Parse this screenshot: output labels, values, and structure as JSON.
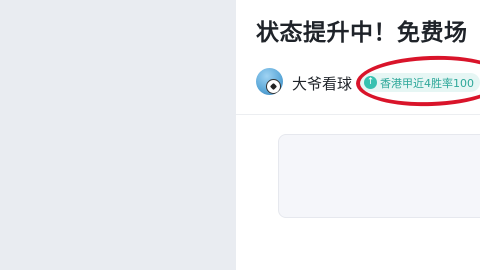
{
  "article": {
    "title": "状态提升中！免费场",
    "author": "大爷看球",
    "badge": {
      "icon": "arrow-up-icon",
      "text": "香港甲近4胜率100"
    }
  },
  "colors": {
    "left_panel_bg": "#e9ecf1",
    "badge_bg": "#e6f6f4",
    "badge_accent": "#38c1b0",
    "highlight": "#d9142a",
    "card_bg": "#f5f6fa"
  }
}
